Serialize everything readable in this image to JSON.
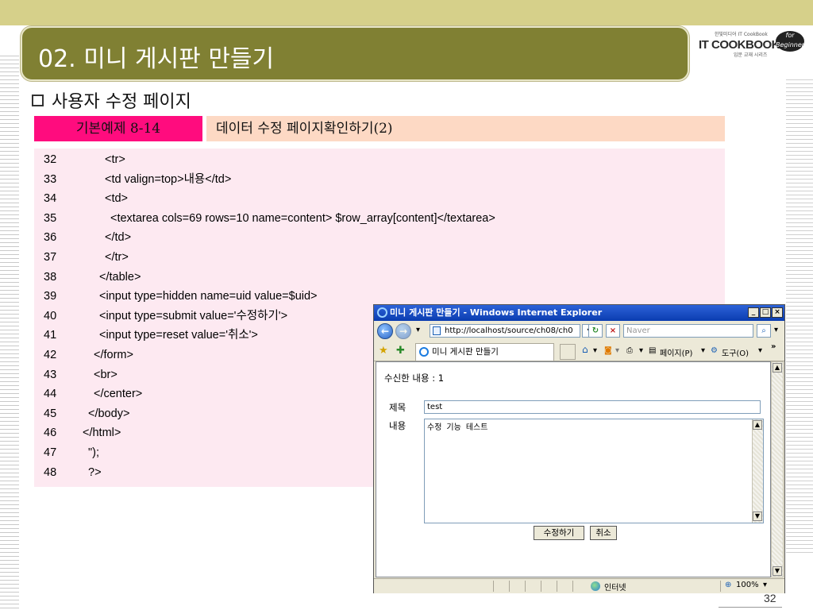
{
  "slide": {
    "title": "02. 미니 게시판 만들기",
    "section": "사용자 수정 페이지",
    "example_label": "기본예제 8-14",
    "example_title": "데이터 수정 페이지확인하기(2)",
    "page_number": "32"
  },
  "logo": {
    "text": "IT COOKBOOK",
    "tagline_top": "한빛미디어 IT CookBook",
    "tagline_bottom": "입문 교재 시리즈",
    "badge": "for Beginner"
  },
  "code": [
    {
      "num": "32",
      "text": "<tr>",
      "indent": 5
    },
    {
      "num": "33",
      "text": "<td valign=top>내용</td>",
      "indent": 5
    },
    {
      "num": "34",
      "text": "<td>",
      "indent": 5
    },
    {
      "num": "35",
      "text": "<textarea cols=69 rows=10 name=content> $row_array[content]</textarea>",
      "indent": 6
    },
    {
      "num": "36",
      "text": "</td>",
      "indent": 5
    },
    {
      "num": "37",
      "text": "</tr>",
      "indent": 5
    },
    {
      "num": "38",
      "text": "</table>",
      "indent": 4
    },
    {
      "num": "39",
      "text": "<input type=hidden name=uid value=$uid>",
      "indent": 4
    },
    {
      "num": "40",
      "text": "<input type=submit value='수정하기'>",
      "indent": 4
    },
    {
      "num": "41",
      "text": "<input type=reset value='취소'>",
      "indent": 4
    },
    {
      "num": "42",
      "text": "</form>",
      "indent": 3
    },
    {
      "num": "43",
      "text": "<br>",
      "indent": 3
    },
    {
      "num": "44",
      "text": "</center>",
      "indent": 3
    },
    {
      "num": "45",
      "text": "</body>",
      "indent": 2
    },
    {
      "num": "46",
      "text": "</html>",
      "indent": 1
    },
    {
      "num": "47",
      "text": "\");",
      "indent": 2
    },
    {
      "num": "48",
      "text": "?>",
      "indent": 2
    }
  ],
  "browser": {
    "window_title": "미니 게시판 만들기 - Windows Internet Explorer",
    "address": "http://localhost/source/ch08/ch0",
    "search_placeholder": "Naver",
    "tab_label": "미니 게시판 만들기",
    "page_menu": "페이지(P)",
    "tools_menu": "도구(O)",
    "received": "수신한 내용 : 1",
    "subject_label": "제목",
    "subject_value": "test",
    "content_label": "내용",
    "content_value": "수정 기능 테스트",
    "submit_label": "수정하기",
    "reset_label": "취소",
    "status_zone": "인터넷",
    "zoom": "100%"
  }
}
